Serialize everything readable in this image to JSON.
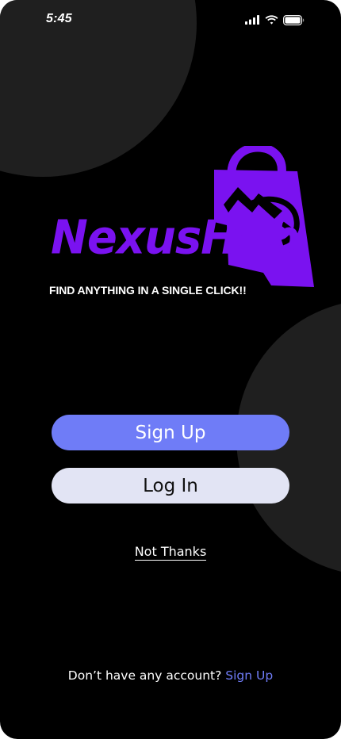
{
  "status_bar": {
    "time": "5:45",
    "icons": [
      "cellular-signal-icon",
      "wifi-icon",
      "battery-icon"
    ]
  },
  "logo": {
    "wordmark": "NexusHub",
    "tagline": "FIND ANYTHING IN A SINGLE CLICK!!",
    "icon": "shopping-bag-icon",
    "color": "#7a12f0"
  },
  "actions": {
    "signup_label": "Sign Up",
    "login_label": "Log In",
    "not_thanks_label": "Not Thanks"
  },
  "footer": {
    "prompt_text": "Don’t have any account?",
    "signup_link": "Sign Up"
  },
  "colors": {
    "background": "#000000",
    "decor_circle": "#1f1f1f",
    "primary": "#6f7cf7",
    "secondary": "#e2e4f4",
    "brand": "#7a12f0"
  }
}
